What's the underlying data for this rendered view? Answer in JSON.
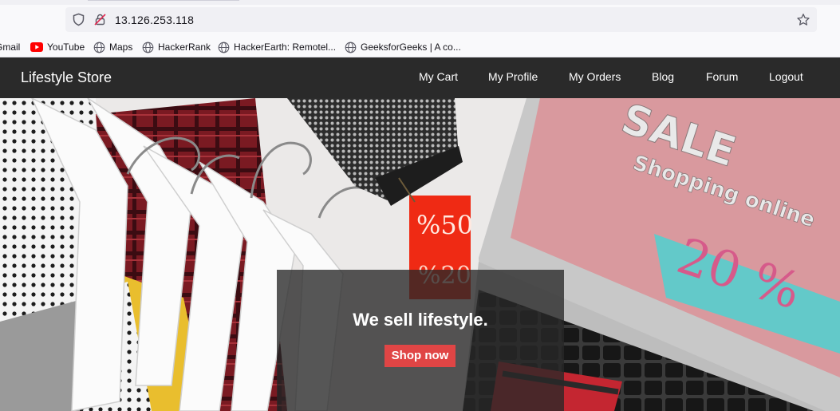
{
  "browser": {
    "url": "13.126.253.118",
    "bookmarks": [
      {
        "label": "Gmail",
        "icon": "gmail-icon"
      },
      {
        "label": "YouTube",
        "icon": "youtube-icon"
      },
      {
        "label": "Maps",
        "icon": "globe-icon"
      },
      {
        "label": "HackerRank",
        "icon": "globe-icon"
      },
      {
        "label": "HackerEarth: Remotel...",
        "icon": "globe-icon"
      },
      {
        "label": "GeeksforGeeks | A co...",
        "icon": "globe-icon"
      }
    ]
  },
  "site": {
    "brand": "Lifestyle Store",
    "nav": [
      {
        "label": "My Cart"
      },
      {
        "label": "My Profile"
      },
      {
        "label": "My Orders"
      },
      {
        "label": "Blog"
      },
      {
        "label": "Forum"
      },
      {
        "label": "Logout"
      }
    ]
  },
  "hero": {
    "headline": "We sell lifestyle.",
    "cta_label": "Shop now",
    "image_text": {
      "sale": "SALE",
      "shopping_online": "Shopping online",
      "percent": "20 %",
      "tag_top": "%50",
      "tag_bottom": "%20"
    }
  },
  "colors": {
    "navbar_bg": "#2a2a2a",
    "cta_bg": "#e04545",
    "youtube_red": "#ff0000"
  }
}
